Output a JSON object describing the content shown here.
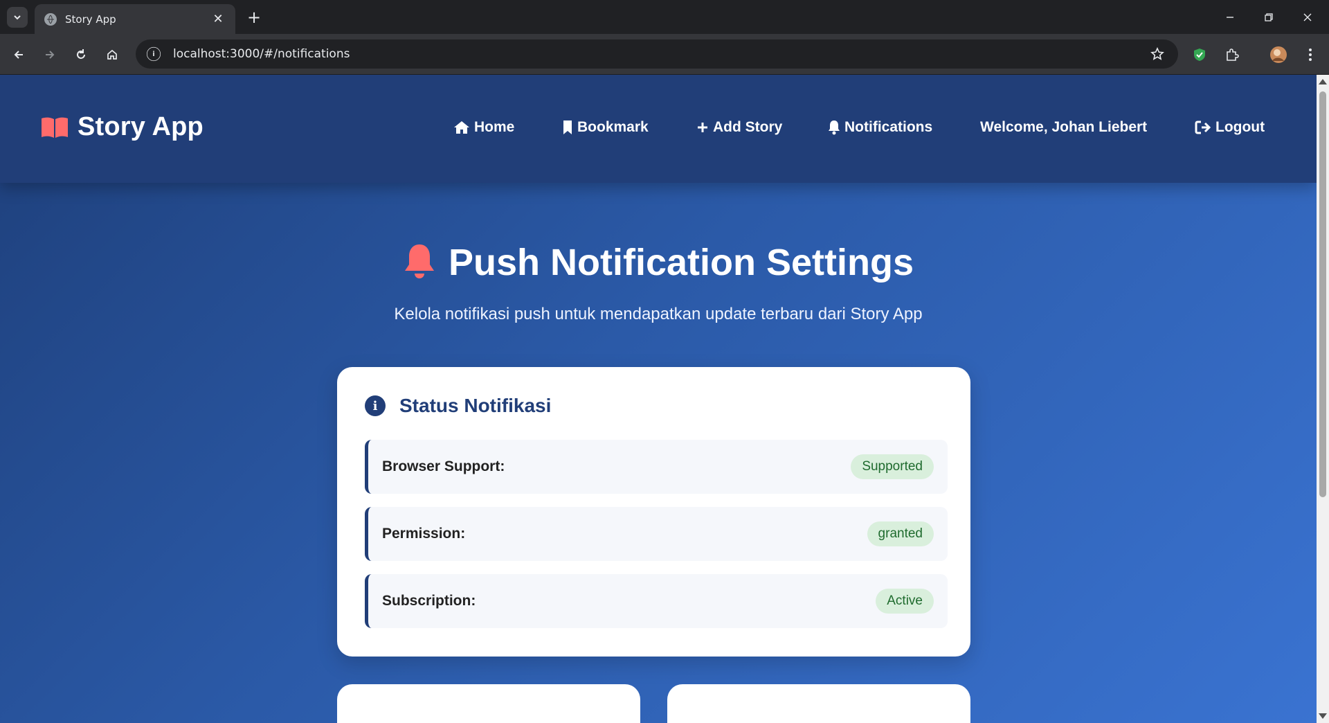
{
  "browser": {
    "tab_title": "Story App",
    "url": "localhost:3000/#/notifications",
    "icons": [
      "tab-list-icon",
      "globe-favicon",
      "close-icon",
      "plus-icon",
      "minimize-icon",
      "restore-icon",
      "window-close-icon",
      "back-icon",
      "forward-icon",
      "reload-icon",
      "home-icon",
      "info-icon",
      "star-icon",
      "shield-icon",
      "puzzle-icon",
      "avatar",
      "menu-icon"
    ]
  },
  "app": {
    "brand": "Story App",
    "brand_icon": "book-open-icon",
    "brand_icon_color": "#ff6b6b",
    "nav": {
      "home": "Home",
      "bookmark": "Bookmark",
      "add_story": "Add Story",
      "notifications": "Notifications",
      "welcome": "Welcome, Johan Liebert",
      "logout": "Logout"
    }
  },
  "page": {
    "title": "Push Notification Settings",
    "title_icon": "bell-icon",
    "subtitle": "Kelola notifikasi push untuk mendapatkan update terbaru dari Story App",
    "status_card": {
      "heading": "Status Notifikasi",
      "rows": [
        {
          "label": "Browser Support:",
          "value": "Supported"
        },
        {
          "label": "Permission:",
          "value": "granted"
        },
        {
          "label": "Subscription:",
          "value": "Active"
        }
      ]
    }
  },
  "colors": {
    "header_bg": "#213e78",
    "accent": "#ff6b6b",
    "badge_bg": "#d9efdc",
    "badge_text": "#1f6b2e"
  }
}
